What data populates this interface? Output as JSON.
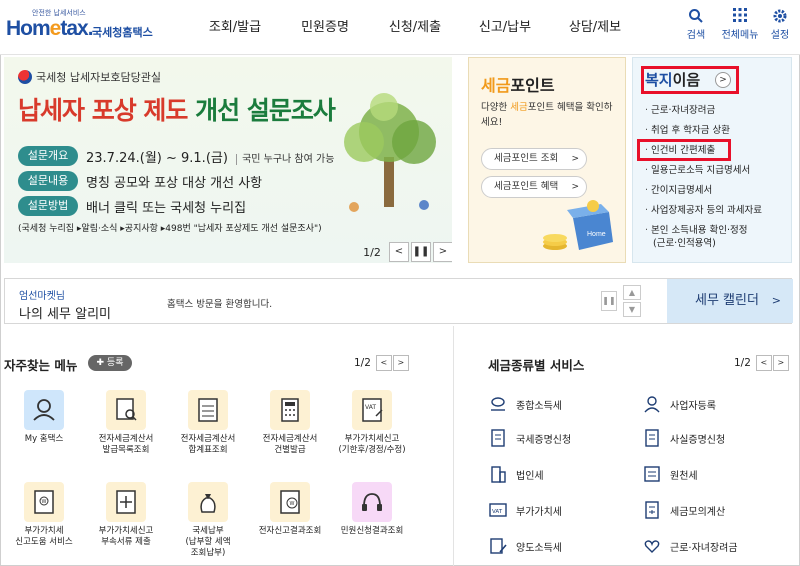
{
  "header": {
    "logo_top": "안전한 납세서비스",
    "logo_main_a": "Hom",
    "logo_main_e": "e",
    "logo_main_b": "tax.",
    "logo_sub": "국세청홈택스",
    "nav": [
      "조회/발급",
      "민원증명",
      "신청/제출",
      "신고/납부",
      "상담/제보"
    ],
    "util": {
      "search": "검색",
      "menu": "전체메뉴",
      "settings": "설정"
    }
  },
  "banner": {
    "org": "국세청 납세자보호담당관실",
    "title_a": "납세자 포상 제도 ",
    "title_b": "개선 설문조사",
    "rows": [
      {
        "tag": "설문개요",
        "text": "23.7.24.(월) ~ 9.1.(금)",
        "extra": "국민 누구나 참여 가능"
      },
      {
        "tag": "설문내용",
        "text": "명칭 공모와 포상 대상 개선 사항",
        "extra": ""
      },
      {
        "tag": "설문방법",
        "text": "배너 클릭 또는 국세청 누리집",
        "extra": ""
      }
    ],
    "note": "(국세청 누리집 ▸알림·소식 ▸공지사항 ▸498번 \"납세자 포상제도 개선 설문조사\")",
    "pager": "1/2"
  },
  "point": {
    "title_a": "세금",
    "title_b": "포인트",
    "desc_a": "다양한 ",
    "desc_b": "세금",
    "desc_c": "포인트 혜택을 확인하세요!",
    "btn1": "세금포인트 조회",
    "btn2": "세금포인트 혜택",
    "box_label": "Home"
  },
  "welfare": {
    "title_a": "복지",
    "title_b": "이음",
    "items": [
      "근로·자녀장려금",
      "취업 후 학자금 상환",
      "인건비 간편제출",
      "일용근로소득 지급명세서",
      "간이지급명세서",
      "사업장제공자 등의 과세자료",
      "본인 소득내용 확인·정정",
      "(근로·인적용역)"
    ]
  },
  "alarm": {
    "name": "엄선마켓님",
    "title": "나의 세무 알리미",
    "message": "홈택스 방문을 환영합니다.",
    "calendar": "세무 캘린더"
  },
  "frequent": {
    "title": "자주찾는 메뉴",
    "add": "✚ 등록",
    "pager": "1/2",
    "tiles": [
      {
        "label": "My 홈택스"
      },
      {
        "label": "전자세금계산서\n발급목록조회"
      },
      {
        "label": "전자세금계산서\n합계표조회"
      },
      {
        "label": "전자세금계산서\n건별발급"
      },
      {
        "label": "부가가치세신고\n(기한후/경정/수정)"
      },
      {
        "label": "부가가치세\n신고도움 서비스"
      },
      {
        "label": "부가가치세신고\n부속서류 제출"
      },
      {
        "label": "국세납부\n(납부할 세액\n조회납부)"
      },
      {
        "label": "전자신고결과조회"
      },
      {
        "label": "민원신청결과조회"
      }
    ]
  },
  "services": {
    "title": "세금종류별 서비스",
    "pager": "1/2",
    "items": [
      {
        "label": "종합소득세"
      },
      {
        "label": "사업자등록"
      },
      {
        "label": "국세증명신청"
      },
      {
        "label": "사실증명신청"
      },
      {
        "label": "법인세"
      },
      {
        "label": "원천세"
      },
      {
        "label": "부가가치세"
      },
      {
        "label": "세금모의계산"
      },
      {
        "label": "양도소득세"
      },
      {
        "label": "근로·자녀장려금"
      }
    ]
  },
  "colors": {
    "brand_blue": "#1e4fa3",
    "accent_orange": "#f19a1b",
    "highlight_red": "#e8102a",
    "banner_tag": "#2e8d8d"
  }
}
